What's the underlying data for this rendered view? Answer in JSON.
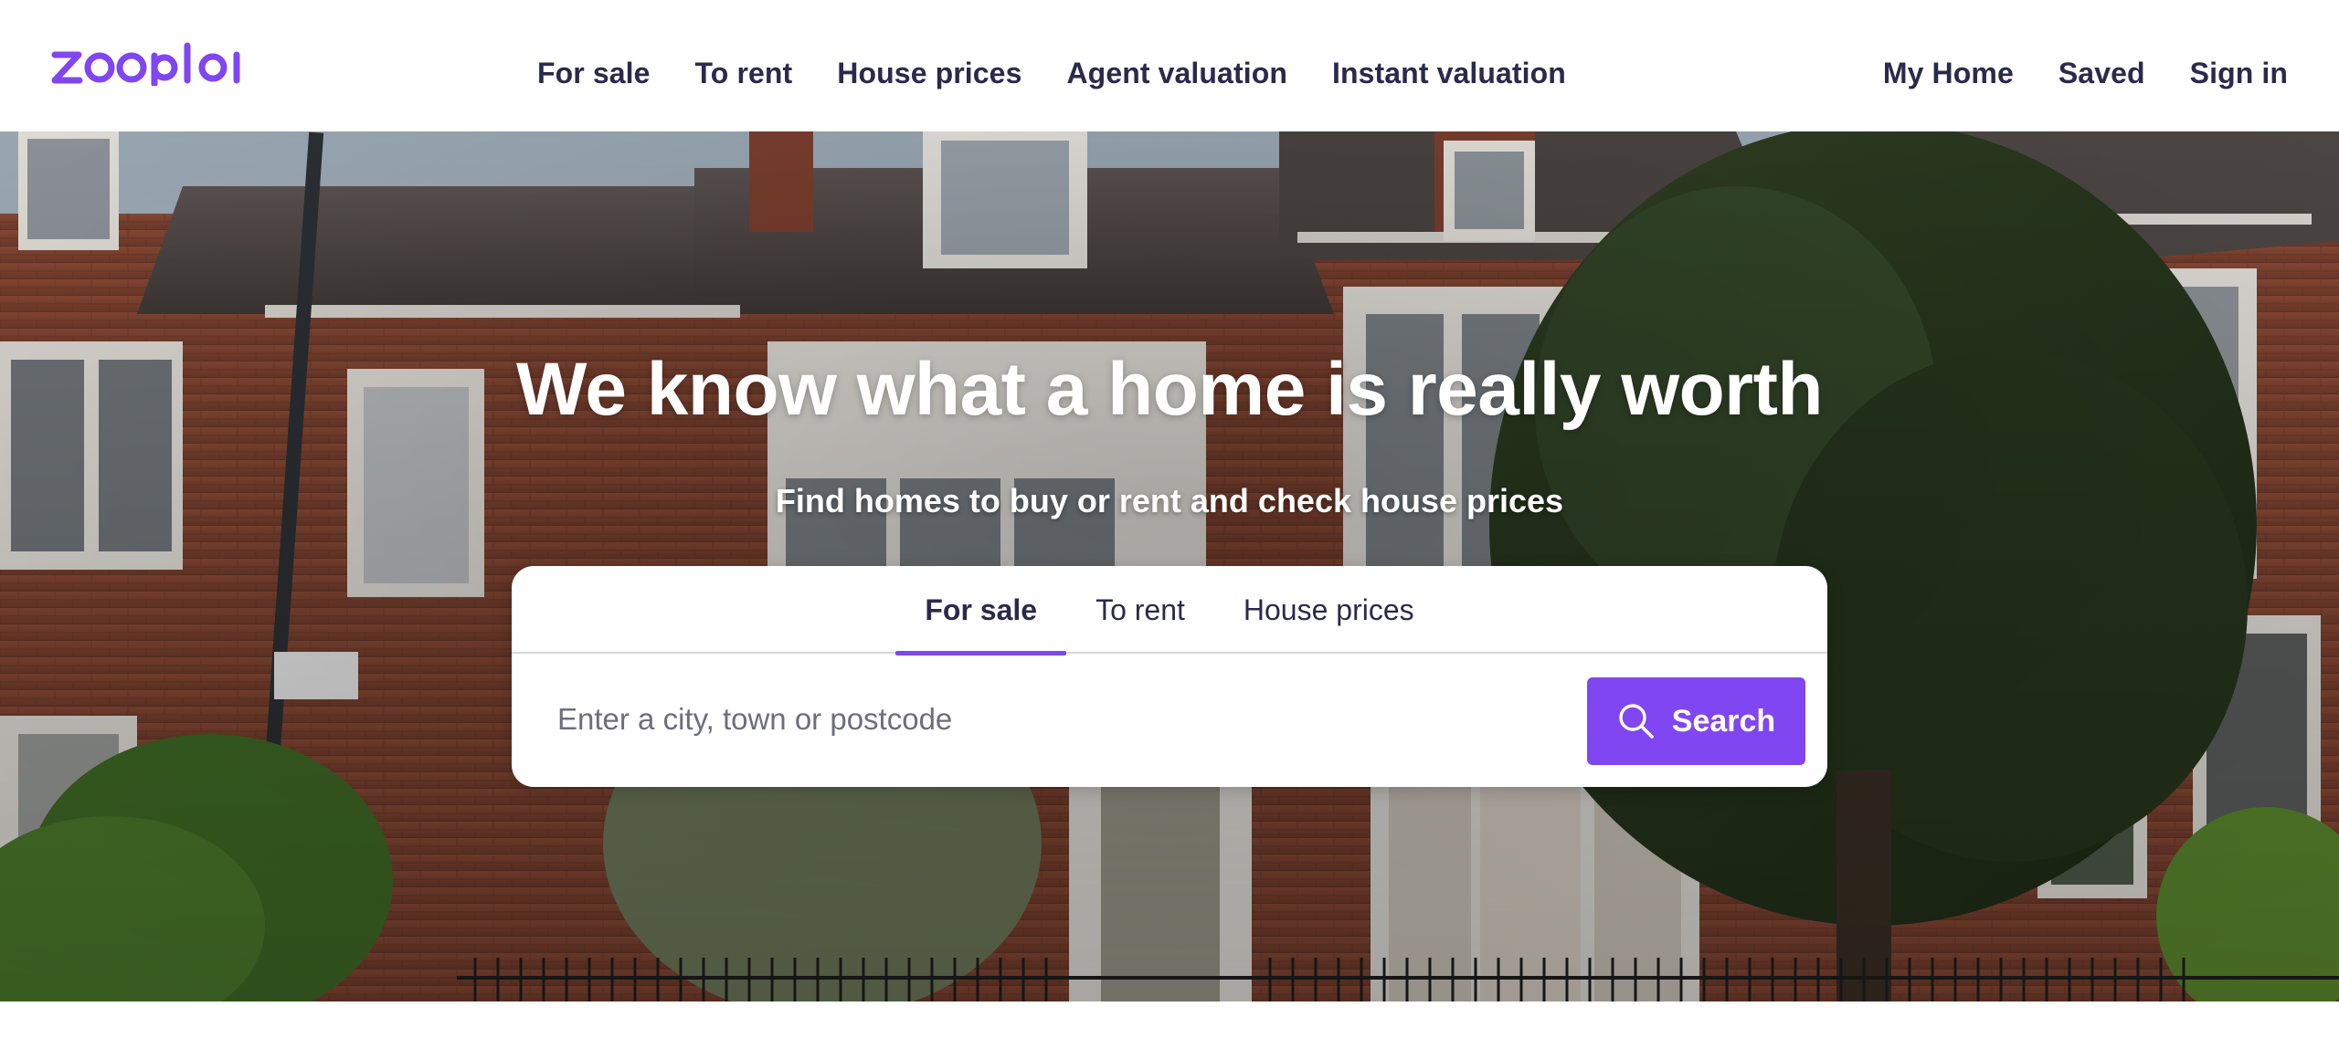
{
  "brand": {
    "name": "zoopla",
    "color": "#8046f1"
  },
  "nav": {
    "main": [
      {
        "label": "For sale"
      },
      {
        "label": "To rent"
      },
      {
        "label": "House prices"
      },
      {
        "label": "Agent valuation"
      },
      {
        "label": "Instant valuation"
      }
    ],
    "account": [
      {
        "label": "My Home"
      },
      {
        "label": "Saved"
      },
      {
        "label": "Sign in"
      }
    ]
  },
  "hero": {
    "headline": "We know what a home is really worth",
    "subheadline": "Find homes to buy or rent and check house prices",
    "background": "photo of red-brick terraced houses with a tree"
  },
  "search": {
    "tabs": [
      {
        "label": "For sale",
        "active": true
      },
      {
        "label": "To rent",
        "active": false
      },
      {
        "label": "House prices",
        "active": false
      }
    ],
    "placeholder": "Enter a city, town or postcode",
    "value": "",
    "button_label": "Search",
    "button_icon": "search-icon",
    "accent_color": "#8046f1"
  }
}
